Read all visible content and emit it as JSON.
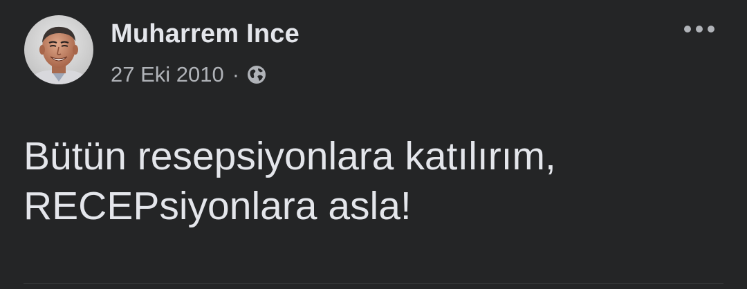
{
  "post": {
    "author": {
      "name": "Muharrem Ince",
      "avatar": "profile-photo"
    },
    "timestamp": "27 Eki 2010",
    "separator": "·",
    "audience_icon": "globe-icon",
    "more_icon": "more-options-icon",
    "text_lines": [
      "Bütün resepsiyonlara katılırım,",
      "RECEPsiyonlara asla!"
    ]
  },
  "colors": {
    "background": "#242526",
    "primary_text": "#e4e6eb",
    "secondary_text": "#b0b3b8"
  }
}
